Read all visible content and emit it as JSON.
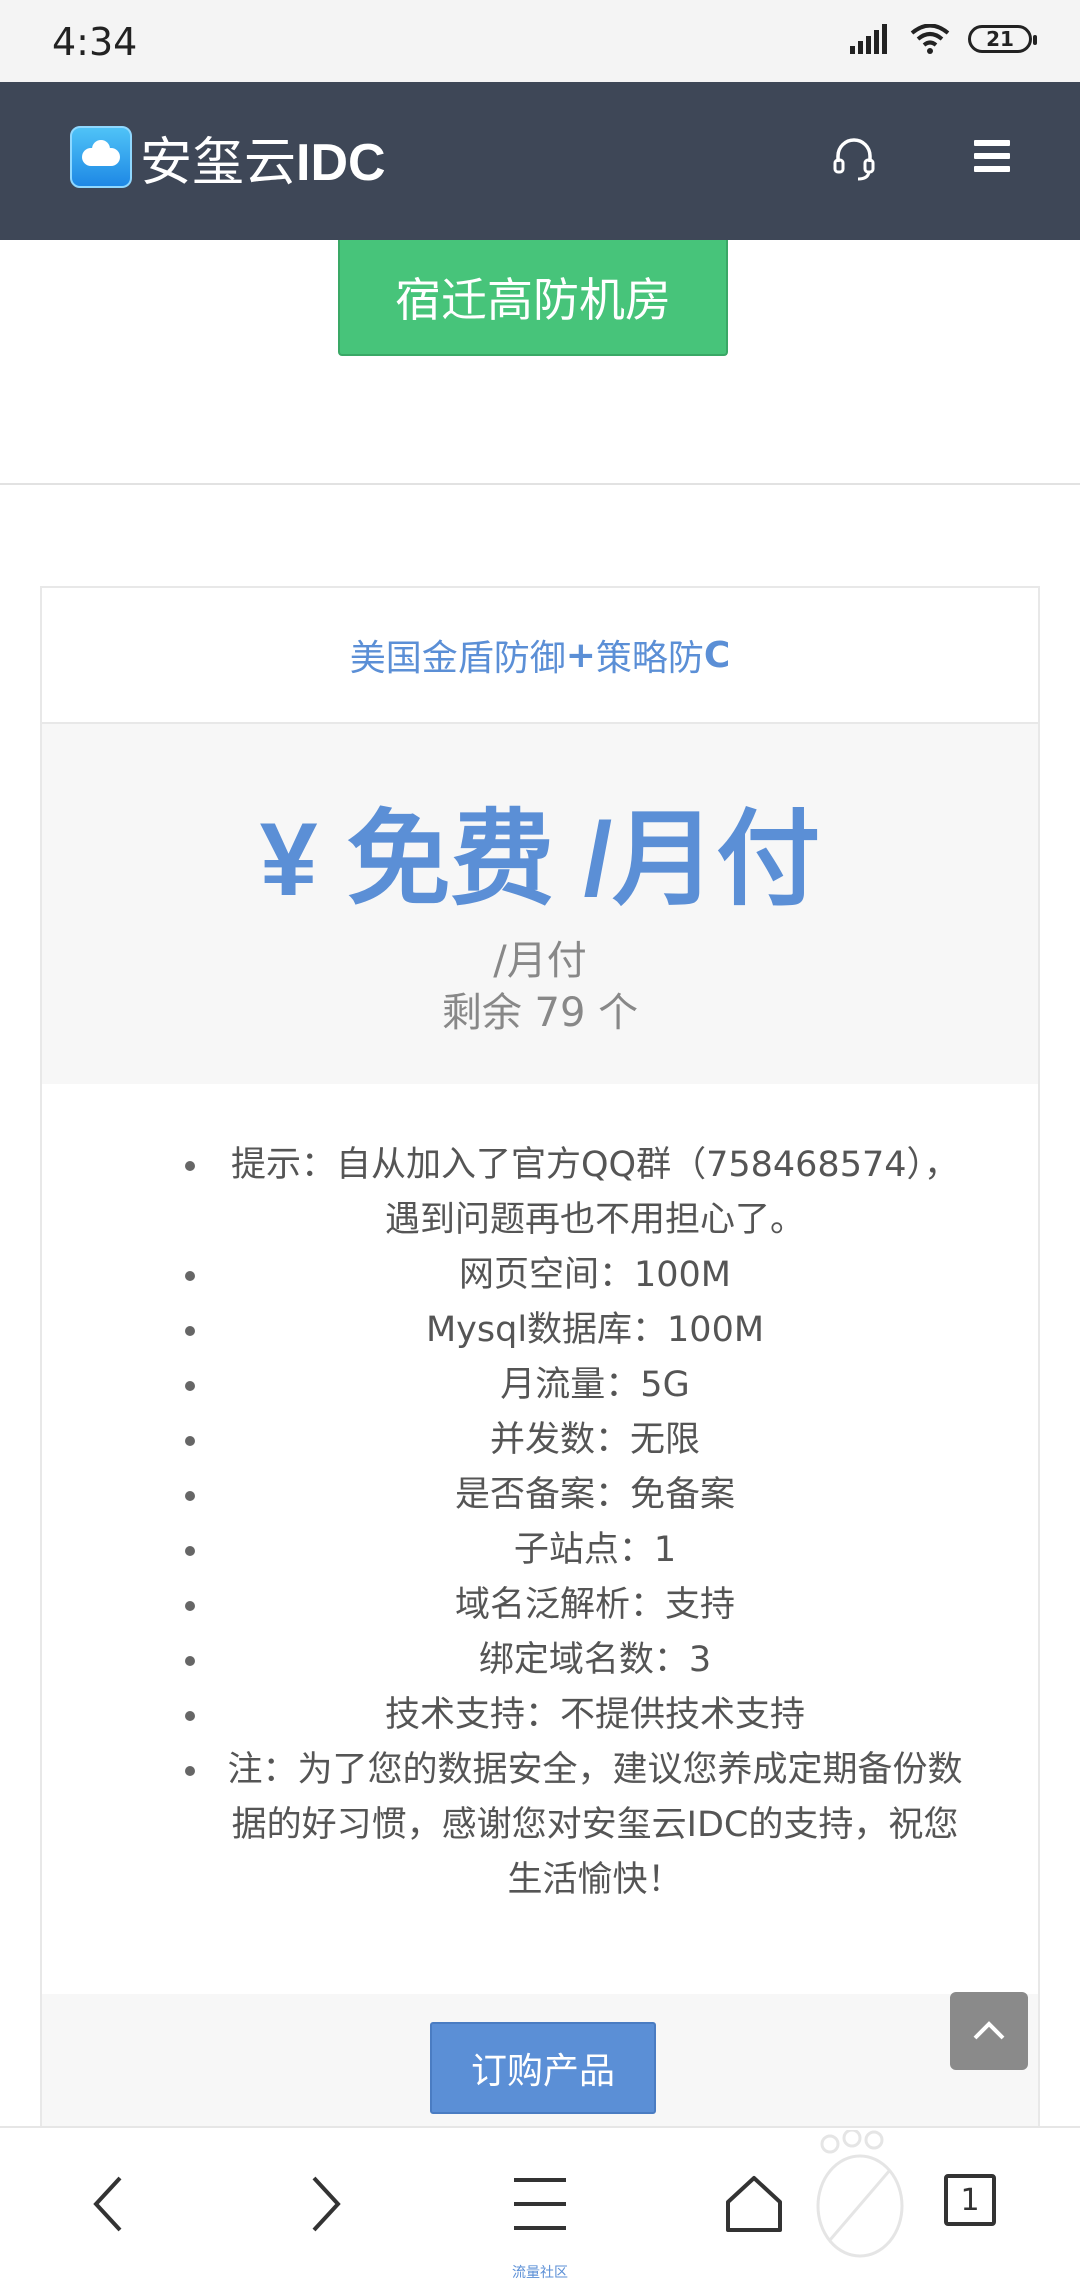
{
  "status_bar": {
    "time": "4:34",
    "battery": "21"
  },
  "header": {
    "brand_prefix": "安玺云",
    "brand_suffix": "IDC"
  },
  "hero": {
    "button_label": "宿迁高防机房"
  },
  "card": {
    "title_prefix": "美国金盾防御",
    "title_plus": "+",
    "title_mid": "策略防",
    "title_c": "C",
    "price": "¥ 免费 /月付",
    "price_unit": "/月付",
    "remaining": "剩余 79 个",
    "features": [
      "提示：自从加入了官方QQ群（758468574），遇到问题再也不用担心了。",
      "网页空间：100M",
      "Mysql数据库：100M",
      "月流量：5G",
      "并发数：无限",
      "是否备案：免备案",
      "子站点：1",
      "域名泛解析：支持",
      "绑定域名数：3",
      "技术支持：不提供技术支持",
      "注：为了您的数据安全，建议您养成定期备份数据的好习惯，感谢您对安玺云IDC的支持，祝您生活愉快！"
    ],
    "order_label": "订购产品"
  },
  "bottom_nav": {
    "tab_count": "1",
    "watermark": "流量社区"
  },
  "colors": {
    "header_bg": "#3e4757",
    "green": "#47c47a",
    "blue": "#5b8fd6"
  }
}
